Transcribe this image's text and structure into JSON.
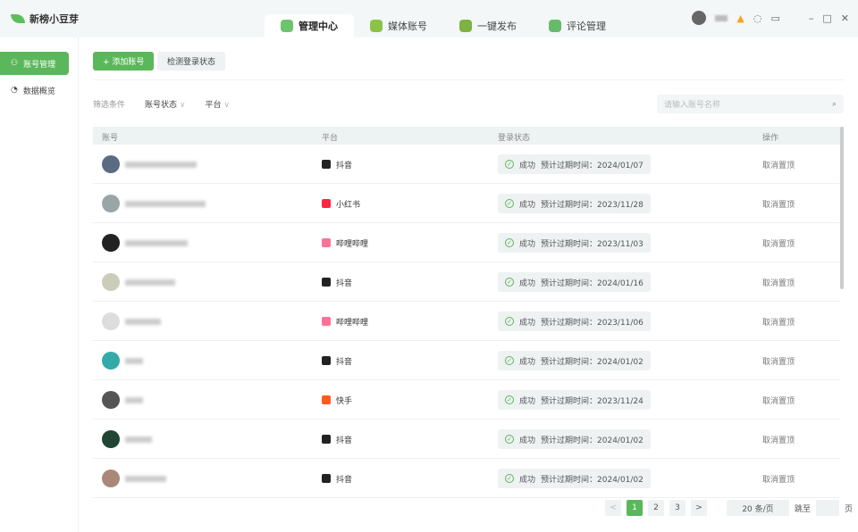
{
  "app": {
    "title": "新榜小豆芽"
  },
  "tabs": [
    {
      "label": "管理中心",
      "color": "#6cc46c"
    },
    {
      "label": "媒体账号",
      "color": "#8bc34a"
    },
    {
      "label": "一键发布",
      "color": "#7cb342"
    },
    {
      "label": "评论管理",
      "color": "#66bb6a"
    }
  ],
  "sidebar": {
    "items": [
      {
        "label": "账号管理"
      },
      {
        "label": "数据概览"
      }
    ]
  },
  "toolbar": {
    "add": "+ 添加账号",
    "check": "检测登录状态"
  },
  "filters": {
    "label": "筛选条件",
    "status": "账号状态",
    "platform": "平台"
  },
  "search": {
    "placeholder": "请输入账号名称"
  },
  "table": {
    "headers": [
      "账号",
      "平台",
      "登录状态",
      "操作"
    ],
    "rows": [
      {
        "platform": "抖音",
        "pcolor": "#222",
        "status": "成功",
        "expire": "预计过期时间：2024/01/07",
        "action": "取消置顶"
      },
      {
        "platform": "小红书",
        "pcolor": "#ff2442",
        "status": "成功",
        "expire": "预计过期时间：2023/11/28",
        "action": "取消置顶"
      },
      {
        "platform": "哔哩哔哩",
        "pcolor": "#fb7299",
        "status": "成功",
        "expire": "预计过期时间：2023/11/03",
        "action": "取消置顶"
      },
      {
        "platform": "抖音",
        "pcolor": "#222",
        "status": "成功",
        "expire": "预计过期时间：2024/01/16",
        "action": "取消置顶"
      },
      {
        "platform": "哔哩哔哩",
        "pcolor": "#fb7299",
        "status": "成功",
        "expire": "预计过期时间：2023/11/06",
        "action": "取消置顶"
      },
      {
        "platform": "抖音",
        "pcolor": "#222",
        "status": "成功",
        "expire": "预计过期时间：2024/01/02",
        "action": "取消置顶"
      },
      {
        "platform": "快手",
        "pcolor": "#ff5a1f",
        "status": "成功",
        "expire": "预计过期时间：2023/11/24",
        "action": "取消置顶"
      },
      {
        "platform": "抖音",
        "pcolor": "#222",
        "status": "成功",
        "expire": "预计过期时间：2024/01/02",
        "action": "取消置顶"
      },
      {
        "platform": "抖音",
        "pcolor": "#222",
        "status": "成功",
        "expire": "预计过期时间：2024/01/02",
        "action": "取消置顶"
      }
    ]
  },
  "pagination": {
    "prev": "<",
    "pages": [
      "1",
      "2",
      "3"
    ],
    "next": ">",
    "current": 1,
    "page_size": "20 条/页",
    "jump_label": "跳至",
    "page_unit": "页"
  }
}
